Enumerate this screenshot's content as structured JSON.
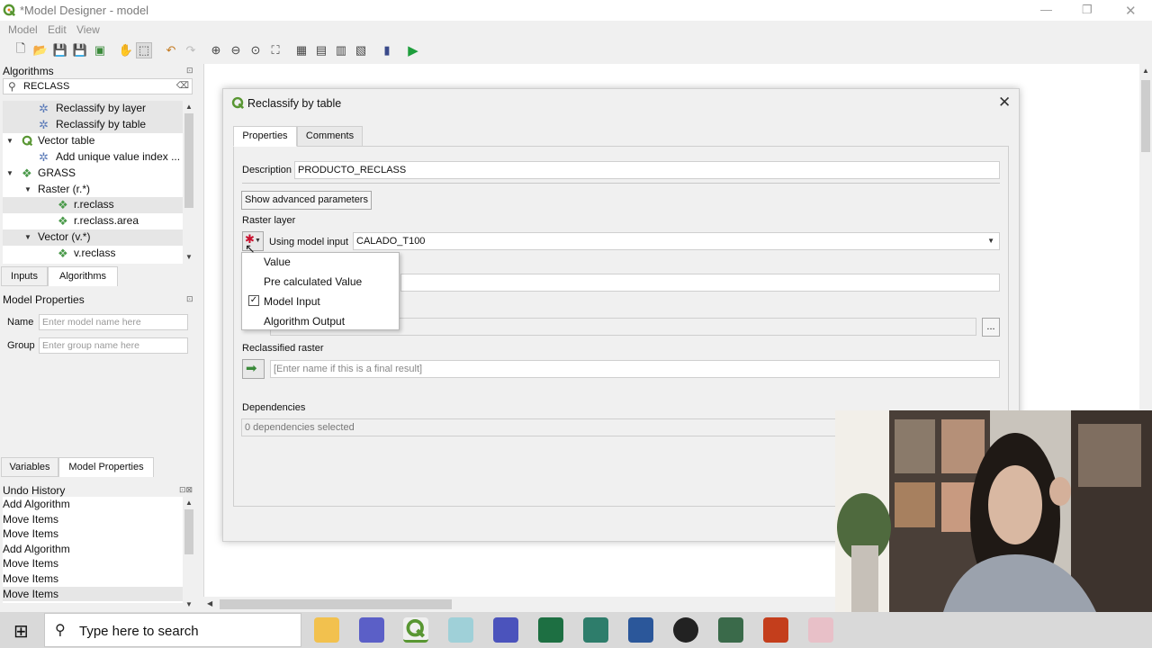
{
  "window": {
    "title": "*Model Designer - model"
  },
  "menu": {
    "items": [
      "Model",
      "Edit",
      "View"
    ]
  },
  "algorithms_panel": {
    "title": "Algorithms",
    "search_value": "RECLASS",
    "tree": [
      {
        "label": "Reclassify by layer"
      },
      {
        "label": "Reclassify by table"
      },
      {
        "label": "Vector table"
      },
      {
        "label": "Add unique value index ..."
      },
      {
        "label": "GRASS"
      },
      {
        "label": "Raster (r.*)"
      },
      {
        "label": "r.reclass"
      },
      {
        "label": "r.reclass.area"
      },
      {
        "label": "Vector (v.*)"
      },
      {
        "label": "v.reclass"
      }
    ],
    "tabs": [
      "Inputs",
      "Algorithms"
    ]
  },
  "model_properties": {
    "title": "Model Properties",
    "name_label": "Name",
    "name_placeholder": "Enter model name here",
    "group_label": "Group",
    "group_placeholder": "Enter group name here",
    "tabs": [
      "Variables",
      "Model Properties"
    ]
  },
  "undo_history": {
    "title": "Undo History",
    "items": [
      "Add Algorithm",
      "Move Items",
      "Move Items",
      "Add Algorithm",
      "Move Items",
      "Move Items",
      "Move Items"
    ]
  },
  "dialog": {
    "title": "Reclassify by table",
    "tabs": [
      "Properties",
      "Comments"
    ],
    "description_label": "Description",
    "description_value": "PRODUCTO_RECLASS",
    "advanced_button": "Show advanced parameters",
    "raster_layer_label": "Raster layer",
    "source_mode_label": "Using model input",
    "raster_value": "CALADO_T100",
    "browse_button": "...",
    "reclassified_label": "Reclassified raster",
    "reclassified_placeholder": "[Enter name if this is a final result]",
    "dependencies_label": "Dependencies",
    "dependencies_value": "0 dependencies selected"
  },
  "popup_menu": {
    "items": [
      {
        "label": "Value",
        "checked": false
      },
      {
        "label": "Pre calculated Value",
        "checked": false
      },
      {
        "label": "Model Input",
        "checked": true
      },
      {
        "label": "Algorithm Output",
        "checked": false
      }
    ]
  },
  "taskbar": {
    "search_placeholder": "Type here to search"
  },
  "colors": {
    "qgis_green": "#589632",
    "accent_play": "#1e9e3c"
  }
}
